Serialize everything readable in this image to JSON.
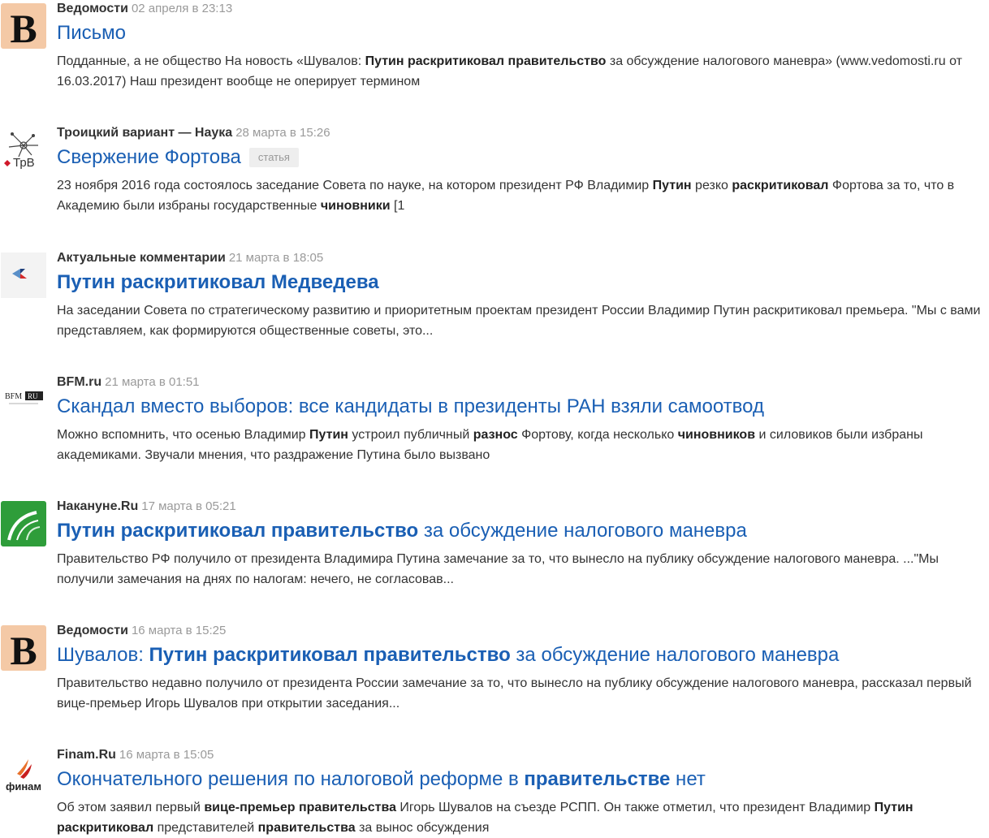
{
  "results": [
    {
      "source": "Ведомости",
      "date": "02 апреля в 23:13",
      "logo": "vedomosti-logo",
      "title": [
        {
          "t": "Письмо"
        }
      ],
      "tag": "",
      "snippet": [
        {
          "t": "Подданные, а не общество На новость «Шувалов: "
        },
        {
          "t": "Путин раскритиковал правительство",
          "b": true
        },
        {
          "t": " за обсуждение налогового маневра» (www.vedomosti.ru от 16.03.2017) Наш президент вообще не оперирует термином"
        }
      ]
    },
    {
      "source": "Троицкий вариант — Наука",
      "date": "28 марта в 15:26",
      "logo": "trv-logo",
      "logo_text": "ТрВ",
      "title": [
        {
          "t": "Свержение Фортова"
        }
      ],
      "tag": "статья",
      "snippet": [
        {
          "t": "23 ноября 2016 года состоялось заседание Совета по науке, на котором президент РФ Владимир "
        },
        {
          "t": "Путин",
          "b": true
        },
        {
          "t": " резко "
        },
        {
          "t": "раскритиковал",
          "b": true
        },
        {
          "t": " Фортова за то, что в Академию были избраны государственные "
        },
        {
          "t": "чиновники",
          "b": true
        },
        {
          "t": " [1"
        }
      ]
    },
    {
      "source": "Актуальные комментарии",
      "date": "21 марта в 18:05",
      "logo": "aktualnye-kommentarii-logo",
      "title": [
        {
          "t": "Путин раскритиковал Медведева",
          "b": true
        }
      ],
      "tag": "",
      "snippet": [
        {
          "t": "На заседании Совета по стратегическому развитию и приоритетным проектам президент России Владимир Путин раскритиковал премьера. \"Мы с вами представляем, как формируются общественные советы, это..."
        }
      ]
    },
    {
      "source": "BFM.ru",
      "date": "21 марта в 01:51",
      "logo": "bfm-logo",
      "logo_text": "BFM RU",
      "title": [
        {
          "t": "Скандал вместо выборов: все кандидаты в президенты РАН взяли самоотвод"
        }
      ],
      "tag": "",
      "snippet": [
        {
          "t": "Можно вспомнить, что осенью Владимир "
        },
        {
          "t": "Путин",
          "b": true
        },
        {
          "t": " устроил публичный "
        },
        {
          "t": "разнос",
          "b": true
        },
        {
          "t": " Фортову, когда несколько "
        },
        {
          "t": "чиновников",
          "b": true
        },
        {
          "t": " и силовиков были избраны академиками. Звучали мнения, что раздражение Путина было вызвано"
        }
      ]
    },
    {
      "source": "Накануне.Ru",
      "date": "17 марта в 05:21",
      "logo": "nakanune-logo",
      "title": [
        {
          "t": "Путин раскритиковал правительство",
          "b": true
        },
        {
          "t": " за обсуждение налогового маневра"
        }
      ],
      "tag": "",
      "snippet": [
        {
          "t": "Правительство РФ получило от президента Владимира Путина замечание за то, что вынесло на публику обсуждение налогового маневра. ...\"Мы получили замечания на днях по налогам: нечего, не согласовав..."
        }
      ]
    },
    {
      "source": "Ведомости",
      "date": "16 марта в 15:25",
      "logo": "vedomosti-logo",
      "title": [
        {
          "t": "Шувалов: "
        },
        {
          "t": "Путин раскритиковал правительство",
          "b": true
        },
        {
          "t": " за обсуждение налогового маневра"
        }
      ],
      "tag": "",
      "snippet": [
        {
          "t": "Правительство недавно получило от президента России замечание за то, что вынесло на публику обсуждение налогового маневра, рассказал первый вице-премьер Игорь Шувалов при открытии заседания..."
        }
      ]
    },
    {
      "source": "Finam.Ru",
      "date": "16 марта в 15:05",
      "logo": "finam-logo",
      "logo_text": "финам",
      "title": [
        {
          "t": "Окончательного решения по налоговой реформе в "
        },
        {
          "t": "правительстве",
          "b": true
        },
        {
          "t": " нет"
        }
      ],
      "tag": "",
      "snippet": [
        {
          "t": "Об этом заявил первый "
        },
        {
          "t": "вице-премьер правительства",
          "b": true
        },
        {
          "t": " Игорь Шувалов на съезде РСПП. Он также отметил, что президент Владимир "
        },
        {
          "t": "Путин раскритиковал",
          "b": true
        },
        {
          "t": " представителей "
        },
        {
          "t": "правительства",
          "b": true
        },
        {
          "t": " за вынос обсуждения"
        }
      ]
    }
  ]
}
